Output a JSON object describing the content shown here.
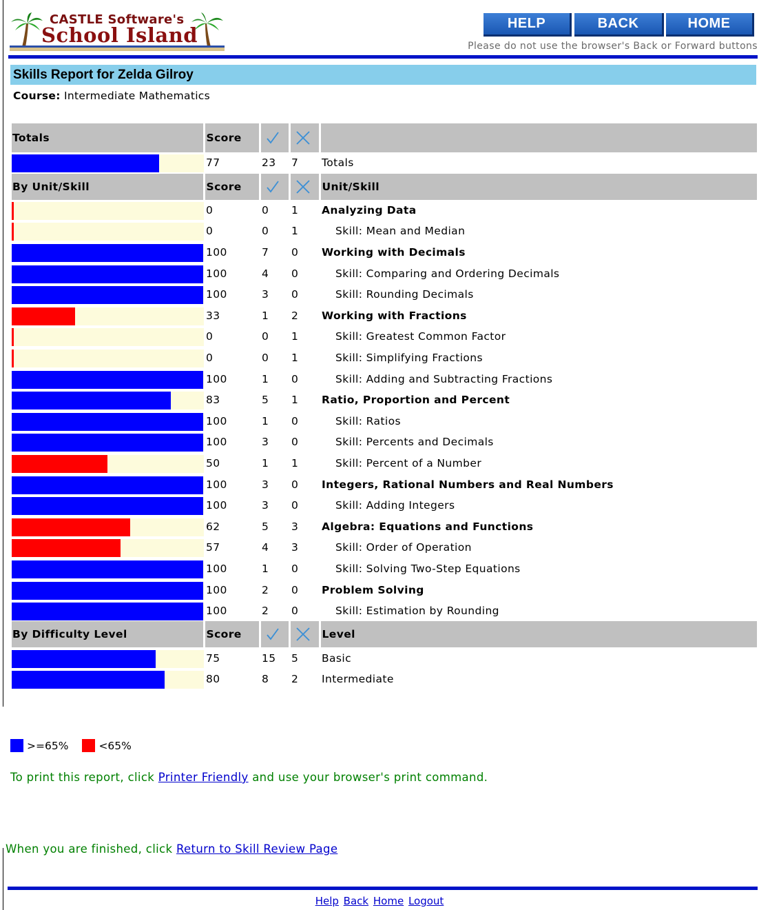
{
  "header": {
    "logo": {
      "line1": "CASTLE Software's",
      "line2": "School Island"
    },
    "buttons": [
      "HELP",
      "BACK",
      "HOME"
    ],
    "notice": "Please do not use the browser's Back or Forward buttons"
  },
  "report": {
    "title": "Skills Report for Zelda Gilroy",
    "course_label": "Course:",
    "course_value": "Intermediate Mathematics"
  },
  "colors": {
    "pass": "#0000ff",
    "fail": "#ff0000",
    "bar_bg": "#fdfbdc",
    "header_bg": "#c0c0c0",
    "title_bg": "#87ceeb"
  },
  "sections": [
    {
      "label": "Totals",
      "score_header": "Score",
      "name_header": "",
      "rows": [
        {
          "score": 77,
          "correct": 23,
          "wrong": 7,
          "name": "Totals",
          "kind": "plain"
        }
      ]
    },
    {
      "label": "By Unit/Skill",
      "score_header": "Score",
      "name_header": "Unit/Skill",
      "rows": [
        {
          "score": 0,
          "correct": 0,
          "wrong": 1,
          "name": "Analyzing Data",
          "kind": "unit"
        },
        {
          "score": 0,
          "correct": 0,
          "wrong": 1,
          "name": "Skill: Mean and Median",
          "kind": "skill"
        },
        {
          "score": 100,
          "correct": 7,
          "wrong": 0,
          "name": "Working with Decimals",
          "kind": "unit"
        },
        {
          "score": 100,
          "correct": 4,
          "wrong": 0,
          "name": "Skill: Comparing and Ordering Decimals",
          "kind": "skill"
        },
        {
          "score": 100,
          "correct": 3,
          "wrong": 0,
          "name": "Skill: Rounding Decimals",
          "kind": "skill"
        },
        {
          "score": 33,
          "correct": 1,
          "wrong": 2,
          "name": "Working with Fractions",
          "kind": "unit"
        },
        {
          "score": 0,
          "correct": 0,
          "wrong": 1,
          "name": "Skill: Greatest Common Factor",
          "kind": "skill"
        },
        {
          "score": 0,
          "correct": 0,
          "wrong": 1,
          "name": "Skill: Simplifying Fractions",
          "kind": "skill"
        },
        {
          "score": 100,
          "correct": 1,
          "wrong": 0,
          "name": "Skill: Adding and Subtracting Fractions",
          "kind": "skill"
        },
        {
          "score": 83,
          "correct": 5,
          "wrong": 1,
          "name": "Ratio, Proportion and Percent",
          "kind": "unit"
        },
        {
          "score": 100,
          "correct": 1,
          "wrong": 0,
          "name": "Skill: Ratios",
          "kind": "skill"
        },
        {
          "score": 100,
          "correct": 3,
          "wrong": 0,
          "name": "Skill: Percents and Decimals",
          "kind": "skill"
        },
        {
          "score": 50,
          "correct": 1,
          "wrong": 1,
          "name": "Skill: Percent of a Number",
          "kind": "skill"
        },
        {
          "score": 100,
          "correct": 3,
          "wrong": 0,
          "name": "Integers, Rational Numbers and Real Numbers",
          "kind": "unit"
        },
        {
          "score": 100,
          "correct": 3,
          "wrong": 0,
          "name": "Skill: Adding Integers",
          "kind": "skill"
        },
        {
          "score": 62,
          "correct": 5,
          "wrong": 3,
          "name": "Algebra: Equations and Functions",
          "kind": "unit"
        },
        {
          "score": 57,
          "correct": 4,
          "wrong": 3,
          "name": "Skill: Order of Operation",
          "kind": "skill"
        },
        {
          "score": 100,
          "correct": 1,
          "wrong": 0,
          "name": "Skill: Solving Two-Step Equations",
          "kind": "skill"
        },
        {
          "score": 100,
          "correct": 2,
          "wrong": 0,
          "name": "Problem Solving",
          "kind": "unit"
        },
        {
          "score": 100,
          "correct": 2,
          "wrong": 0,
          "name": "Skill: Estimation by Rounding",
          "kind": "skill"
        }
      ]
    },
    {
      "label": "By Difficulty Level",
      "score_header": "Score",
      "name_header": "Level",
      "rows": [
        {
          "score": 75,
          "correct": 15,
          "wrong": 5,
          "name": "Basic",
          "kind": "plain"
        },
        {
          "score": 80,
          "correct": 8,
          "wrong": 2,
          "name": "Intermediate",
          "kind": "plain"
        }
      ]
    }
  ],
  "legend": {
    "pass_label": ">=65%",
    "fail_label": "<65%"
  },
  "print_note": {
    "before": "To print this report, click ",
    "link": "Printer Friendly",
    "after": " and use your browser's print command."
  },
  "finish_note": {
    "before": "When you are finished, click ",
    "link": "Return to Skill Review Page"
  },
  "footer_links": [
    "Help",
    "Back",
    "Home",
    "Logout"
  ]
}
